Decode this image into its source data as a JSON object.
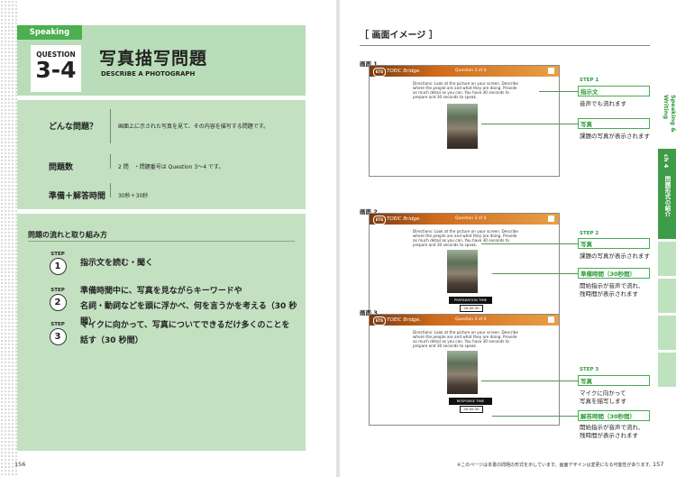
{
  "left_page": {
    "tag": "Speaking",
    "question_label": "QUESTION",
    "question_number": "3-4",
    "title": "写真描写問題",
    "subtitle": "DESCRIBE A PHOTOGRAPH",
    "info": [
      {
        "key": "どんな問題？",
        "value": "画面上に示された写真を見て、その内容を描写する問題です。"
      },
      {
        "key": "問題数",
        "value": "2 問　・問題番号は Question 3～4 です。"
      },
      {
        "key": "準備＋解答時間",
        "value": "30秒＋30秒"
      }
    ],
    "flow_title": "問題の流れと取り組み方",
    "steps": [
      {
        "label": "STEP",
        "num": "1",
        "lines": [
          "指示文を読む・聞く"
        ]
      },
      {
        "label": "STEP",
        "num": "2",
        "lines": [
          "準備時間中に、写真を見ながらキーワードや",
          "名詞・動詞などを頭に浮かべ、何を言うかを考える（30 秒間）"
        ]
      },
      {
        "label": "STEP",
        "num": "3",
        "lines": [
          "マイクに向かって、写真についてできるだけ多くのことを",
          "話す（30 秒間）"
        ]
      }
    ],
    "page_number": "156"
  },
  "right_page": {
    "section_title": "［ 画面イメージ ］",
    "screens": [
      {
        "label": "画面 1",
        "brand": "TOEIC Bridge.",
        "question": "Question 3 of 4",
        "ets": "ETS"
      },
      {
        "label": "画面 2",
        "brand": "TOEIC Bridge.",
        "question": "Question 3 of 4",
        "ets": "ETS",
        "timer_label": "PREPARATION TIME",
        "timer_value": "00:00:30"
      },
      {
        "label": "画面 3",
        "brand": "TOEIC Bridge.",
        "question": "Question 3 of 4",
        "ets": "ETS",
        "timer_label": "RESPONSE TIME",
        "timer_value": "00:00:30"
      }
    ],
    "directions": "Directions: Look at the picture on your screen. Describe where the people are and what they are doing. Provide as much detail as you can. You have 30 seconds to prepare and 30 seconds to speak.",
    "annotations": {
      "step1": "STEP 1",
      "step1_tag": "指示文",
      "step1_desc": "音声でも流れます",
      "photo_tag": "写真",
      "photo_desc": "課題の写真が表示されます",
      "step2": "STEP 2",
      "step2_tag": "写真",
      "step2_desc": "課題の写真が表示されます",
      "prep_tag": "準備時間（30秒間）",
      "prep_desc1": "開始指示が音声で流れ、",
      "prep_desc2": "残時間が表示されます",
      "step3": "STEP 3",
      "step3_tag": "写真",
      "step3_desc1": "マイクに向かって",
      "step3_desc2": "写真を描写します",
      "resp_tag": "解答時間（30秒間）",
      "resp_desc1": "開始指示が音声で流れ、",
      "resp_desc2": "残時間が表示されます"
    },
    "side_tab_top": "Speaking & Writing",
    "side_chapter": "ch 4",
    "side_tab_green": "問題形式の紹介",
    "footnote": "※このページは本書の問題の形式を示しています。画面デザインは変更になる可能性があります。",
    "page_number": "157"
  },
  "colors": {
    "green_dark": "#4caf50",
    "green_light": "#c3e1c1",
    "header_green": "#b9ddb8",
    "accent": "#2e9b3b",
    "toeic_bar": "#d06a1c"
  }
}
